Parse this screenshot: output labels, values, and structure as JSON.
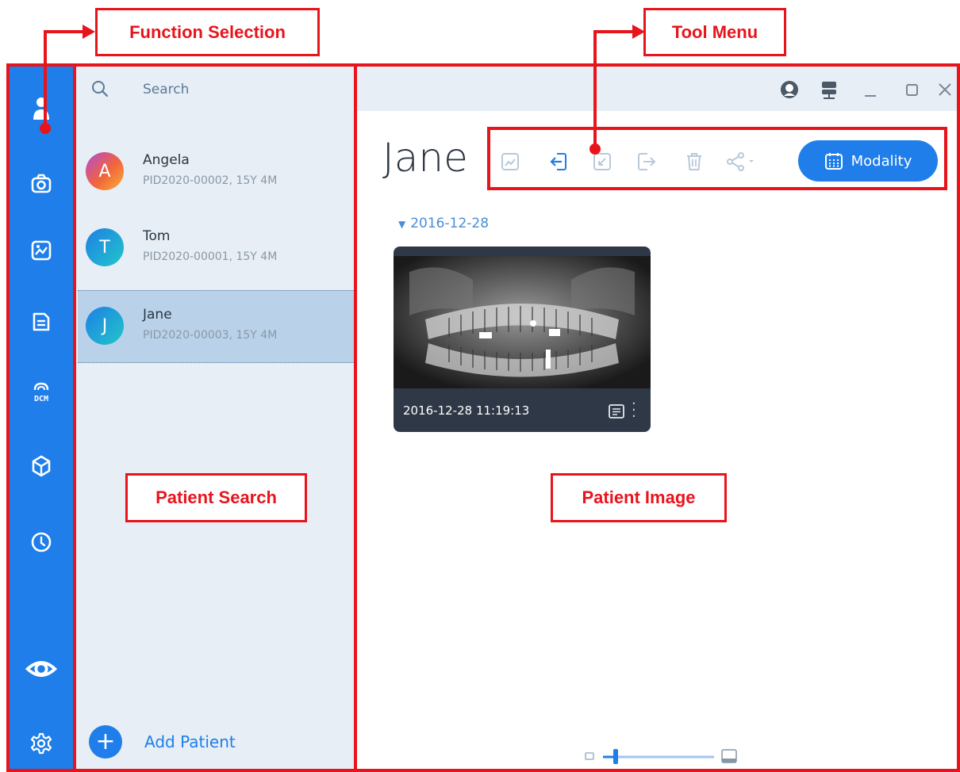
{
  "callouts": {
    "function_selection": "Function Selection",
    "tool_menu": "Tool Menu",
    "patient_search": "Patient Search",
    "patient_image": "Patient Image"
  },
  "sidebar": {
    "items": [
      {
        "name": "patients",
        "icon": "user-icon"
      },
      {
        "name": "capture",
        "icon": "camera-icon"
      },
      {
        "name": "images",
        "icon": "image-icon"
      },
      {
        "name": "report",
        "icon": "document-icon"
      },
      {
        "name": "dicom",
        "icon": "dcm-icon",
        "label": "DCM"
      },
      {
        "name": "3d",
        "icon": "cube-icon"
      },
      {
        "name": "history",
        "icon": "clock-icon"
      },
      {
        "name": "view",
        "icon": "eye-icon"
      },
      {
        "name": "settings",
        "icon": "gear-icon"
      }
    ]
  },
  "search": {
    "placeholder": "Search"
  },
  "patients": [
    {
      "initial": "A",
      "name": "Angela",
      "info": "PID2020-00002, 15Y 4M",
      "color": "#f2653a"
    },
    {
      "initial": "T",
      "name": "Tom",
      "info": "PID2020-00001, 15Y 4M",
      "color": "#1fa7d8"
    },
    {
      "initial": "J",
      "name": "Jane",
      "info": "PID2020-00003, 15Y 4M",
      "color": "#1fa7d8",
      "selected": true
    }
  ],
  "add_patient": {
    "label": "Add Patient"
  },
  "main": {
    "patient_title": "Jane",
    "modality_label": "Modality",
    "study_date": "2016-12-28",
    "image": {
      "timestamp": "2016-12-28 11:19:13"
    }
  },
  "colors": {
    "accent": "#1f7ee9",
    "annotation": "#e8141c",
    "panel": "#e7eef5"
  }
}
